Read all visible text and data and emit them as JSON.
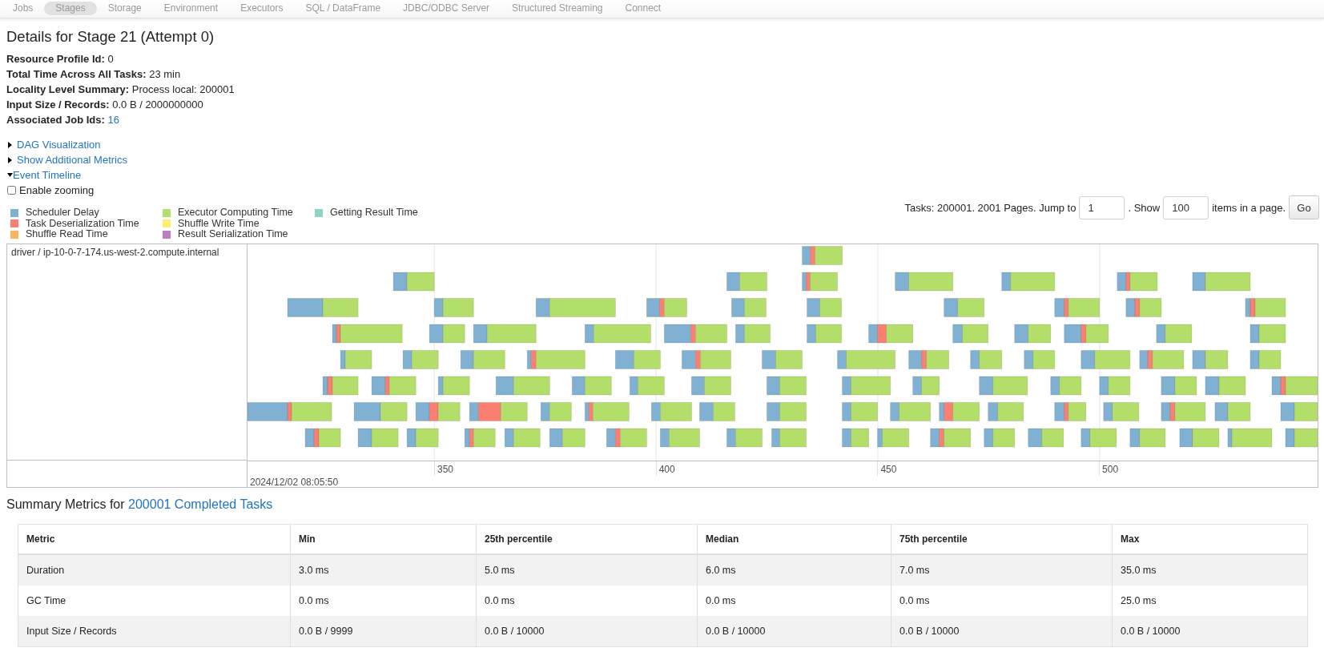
{
  "nav": [
    {
      "label": "Jobs",
      "selected": false
    },
    {
      "label": "Stages",
      "selected": true
    },
    {
      "label": "Storage",
      "selected": false
    },
    {
      "label": "Environment",
      "selected": false
    },
    {
      "label": "Executors",
      "selected": false
    },
    {
      "label": "SQL / DataFrame",
      "selected": false
    },
    {
      "label": "JDBC/ODBC Server",
      "selected": false
    },
    {
      "label": "Structured Streaming",
      "selected": false
    },
    {
      "label": "Connect",
      "selected": false
    }
  ],
  "title": "Details for Stage 21 (Attempt 0)",
  "details": [
    {
      "label": "Resource Profile Id:",
      "value": "0",
      "kind": "text"
    },
    {
      "label": "Total Time Across All Tasks:",
      "value": "23 min",
      "kind": "text"
    },
    {
      "label": "Locality Level Summary:",
      "value": "Process local: 200001",
      "kind": "text"
    },
    {
      "label": "Input Size / Records:",
      "value": "0.0 B / 2000000000",
      "kind": "text"
    },
    {
      "label": "Associated Job Ids:",
      "value": "16",
      "kind": "link"
    }
  ],
  "sections": [
    {
      "label": "DAG Visualization",
      "expanded": false
    },
    {
      "label": "Show Additional Metrics",
      "expanded": false
    },
    {
      "label": "Event Timeline",
      "expanded": true
    }
  ],
  "zoom_toggle": {
    "label": "Enable zooming",
    "checked": false
  },
  "legend": {
    "columns": [
      [
        {
          "label": "Scheduler Delay",
          "color": "#80b1d3"
        },
        {
          "label": "Task Deserialization Time",
          "color": "#fb8072"
        },
        {
          "label": "Shuffle Read Time",
          "color": "#fdb462"
        }
      ],
      [
        {
          "label": "Executor Computing Time",
          "color": "#b3de69"
        },
        {
          "label": "Shuffle Write Time",
          "color": "#ffed6f"
        },
        {
          "label": "Result Serialization Time",
          "color": "#bc80bd"
        }
      ],
      [
        {
          "label": "Getting Result Time",
          "color": "#8dd3c7"
        }
      ]
    ]
  },
  "pagination": {
    "summary": "Tasks: 200001. 2001 Pages. Jump to",
    "page_value": "1",
    "show_label": ". Show",
    "page_size_value": "100",
    "suffix": "items in a page.",
    "button": "Go"
  },
  "timeline": {
    "group_label": "driver / ip-10-0-7-174.us-west-2.compute.internal",
    "axis_labels": [
      "350",
      "400",
      "450",
      "500"
    ],
    "start_label": "2024/12/02 08:05:50"
  },
  "metrics": {
    "heading": "Summary Metrics for",
    "link": "200001 Completed Tasks",
    "columns": [
      "Metric",
      "Min",
      "25th percentile",
      "Median",
      "75th percentile",
      "Max"
    ],
    "rows": [
      [
        "Duration",
        "3.0 ms",
        "5.0 ms",
        "6.0 ms",
        "7.0 ms",
        "35.0 ms"
      ],
      [
        "GC Time",
        "0.0 ms",
        "0.0 ms",
        "0.0 ms",
        "0.0 ms",
        "25.0 ms"
      ],
      [
        "Input Size / Records",
        "0.0 B / 9999",
        "0.0 B / 10000",
        "0.0 B / 10000",
        "0.0 B / 10000",
        "0.0 B / 10000"
      ]
    ]
  }
}
